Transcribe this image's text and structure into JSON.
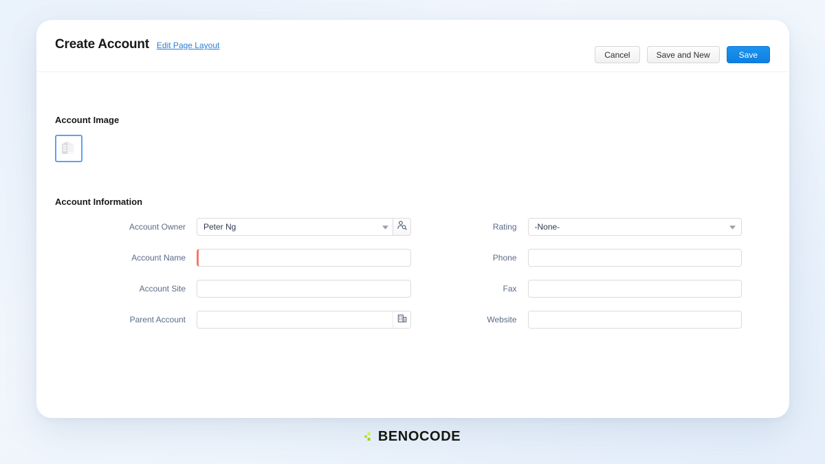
{
  "header": {
    "title": "Create Account",
    "edit_layout_link": "Edit Page Layout",
    "buttons": [
      {
        "label": "Cancel",
        "name": "cancel-button",
        "style": "neutral"
      },
      {
        "label": "Save and New",
        "name": "save-and-new-button",
        "style": "neutral"
      },
      {
        "label": "Save",
        "name": "save-button",
        "style": "brand"
      }
    ]
  },
  "account_image": {
    "heading": "Account Image",
    "icon": "company-building-icon"
  },
  "account_information": {
    "heading": "Account Information",
    "left_fields": [
      {
        "label": "Account Owner",
        "type": "lookup-select",
        "value": "Peter Ng",
        "placeholder": "",
        "required": false,
        "addon_icon": "user-search-icon"
      },
      {
        "label": "Account Name",
        "type": "text",
        "value": "",
        "placeholder": "",
        "required": true,
        "addon_icon": ""
      },
      {
        "label": "Account Site",
        "type": "text",
        "value": "",
        "placeholder": "",
        "required": false,
        "addon_icon": ""
      },
      {
        "label": "Parent Account",
        "type": "lookup",
        "value": "",
        "placeholder": "",
        "required": false,
        "addon_icon": "building-lookup-icon"
      }
    ],
    "right_fields": [
      {
        "label": "Rating",
        "type": "select",
        "value": "-None-",
        "placeholder": "",
        "required": false,
        "addon_icon": "chevron-down-icon"
      },
      {
        "label": "Phone",
        "type": "text",
        "value": "",
        "placeholder": "",
        "required": false,
        "addon_icon": ""
      },
      {
        "label": "Fax",
        "type": "text",
        "value": "",
        "placeholder": "",
        "required": false,
        "addon_icon": ""
      },
      {
        "label": "Website",
        "type": "text",
        "value": "",
        "placeholder": "",
        "required": false,
        "addon_icon": ""
      }
    ]
  },
  "footer": {
    "logo_text": "BENOCODE",
    "logo_mark": "pixel-diamond-icon"
  },
  "colors": {
    "brand_blue": "#0f7fe0",
    "link_blue": "#2a7fd4",
    "required_red": "#f4796b",
    "label_slate": "#5b6b86",
    "logo_green": "#b8e336"
  }
}
